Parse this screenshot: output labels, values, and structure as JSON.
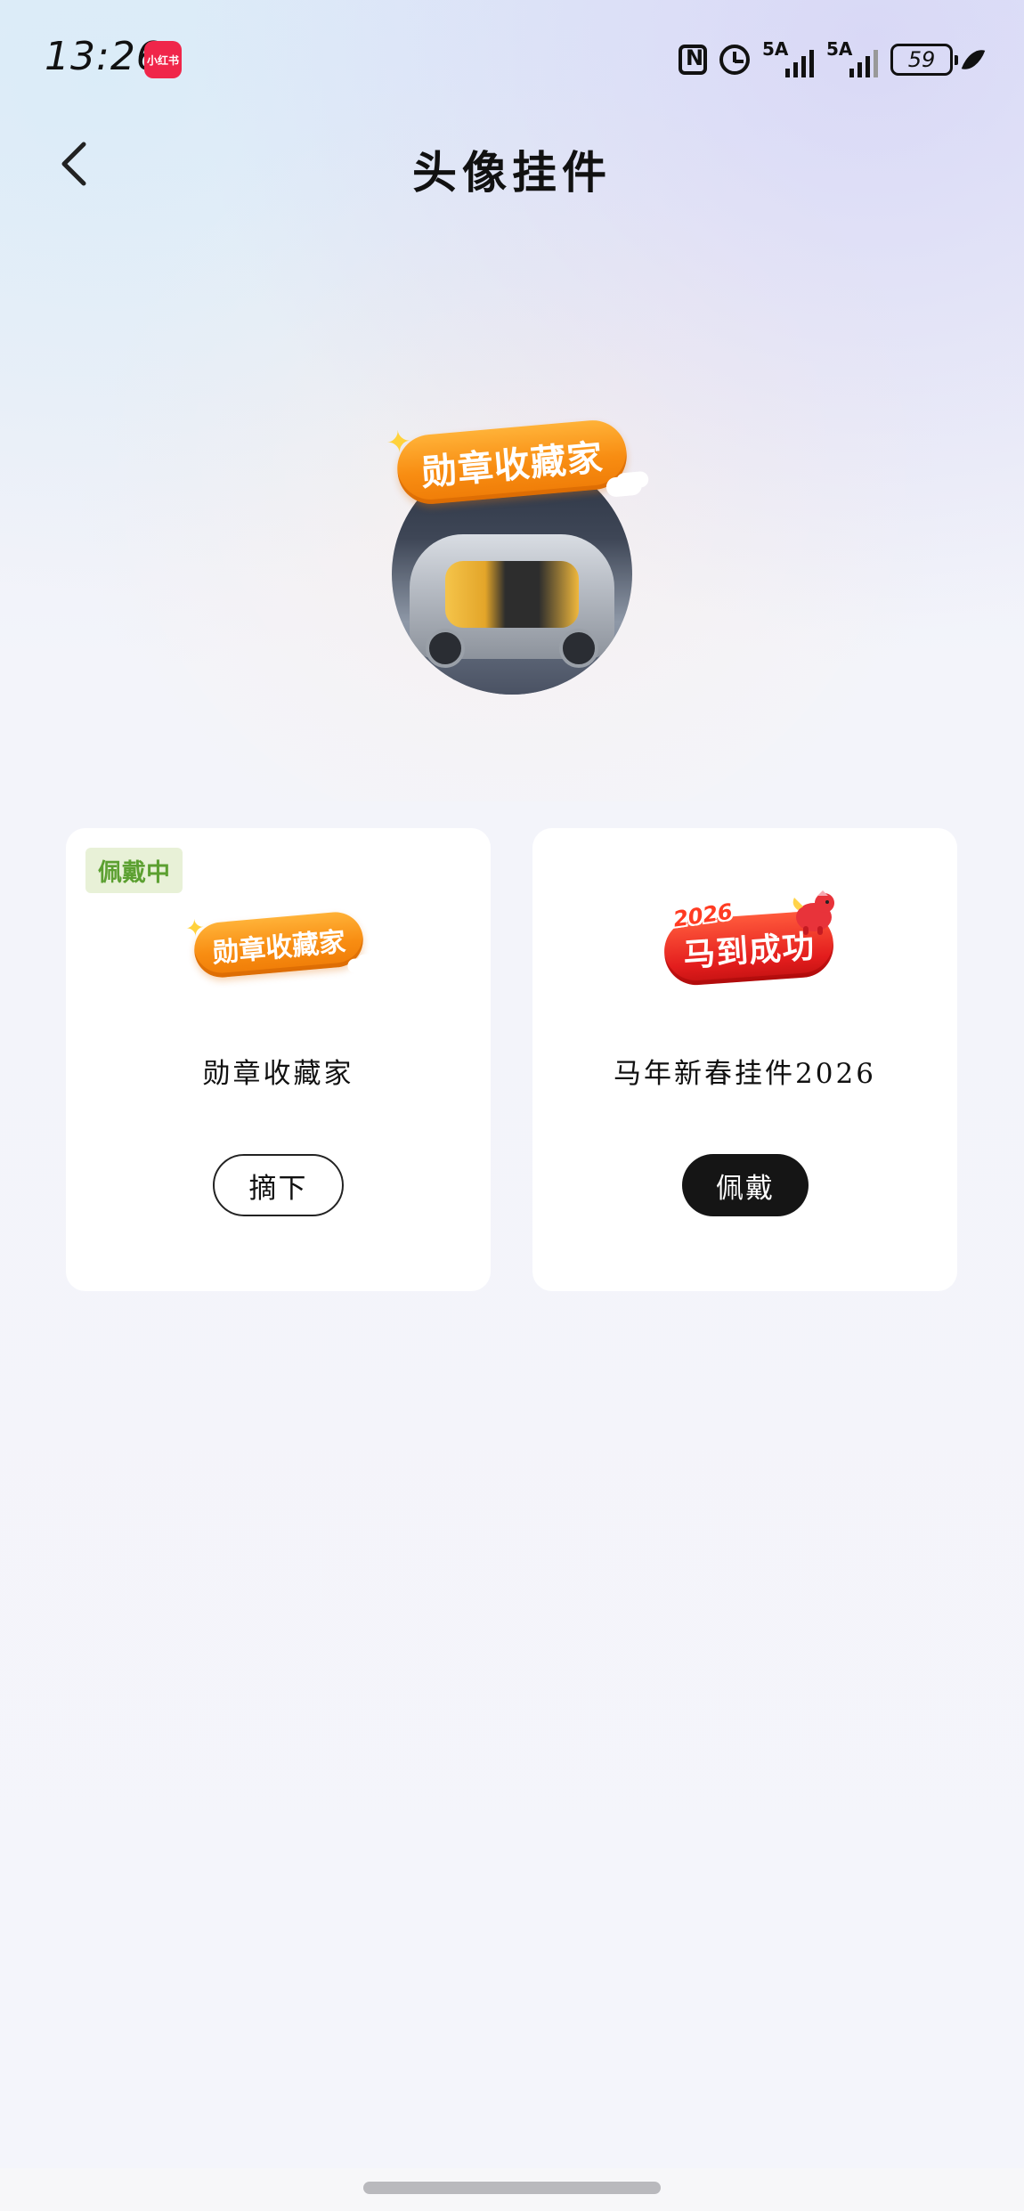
{
  "status_bar": {
    "time": "13:26",
    "app_badge": "小红书",
    "signal_1_label": "5A",
    "signal_2_label": "5A",
    "battery": "59"
  },
  "header": {
    "title": "头像挂件"
  },
  "preview": {
    "pendant_text": "勋章收藏家"
  },
  "pendants": [
    {
      "status_tag": "佩戴中",
      "badge_text": "勋章收藏家",
      "name": "勋章收藏家",
      "action_label": "摘下"
    },
    {
      "badge_year": "2026",
      "badge_text": "马到成功",
      "name": "马年新春挂件2026",
      "action_label": "佩戴"
    }
  ],
  "colors": {
    "wearing_tag_text": "#5ca031",
    "wear_button_bg": "#151515",
    "badge_orange": "#f88d12",
    "badge_red": "#e31d1d"
  }
}
